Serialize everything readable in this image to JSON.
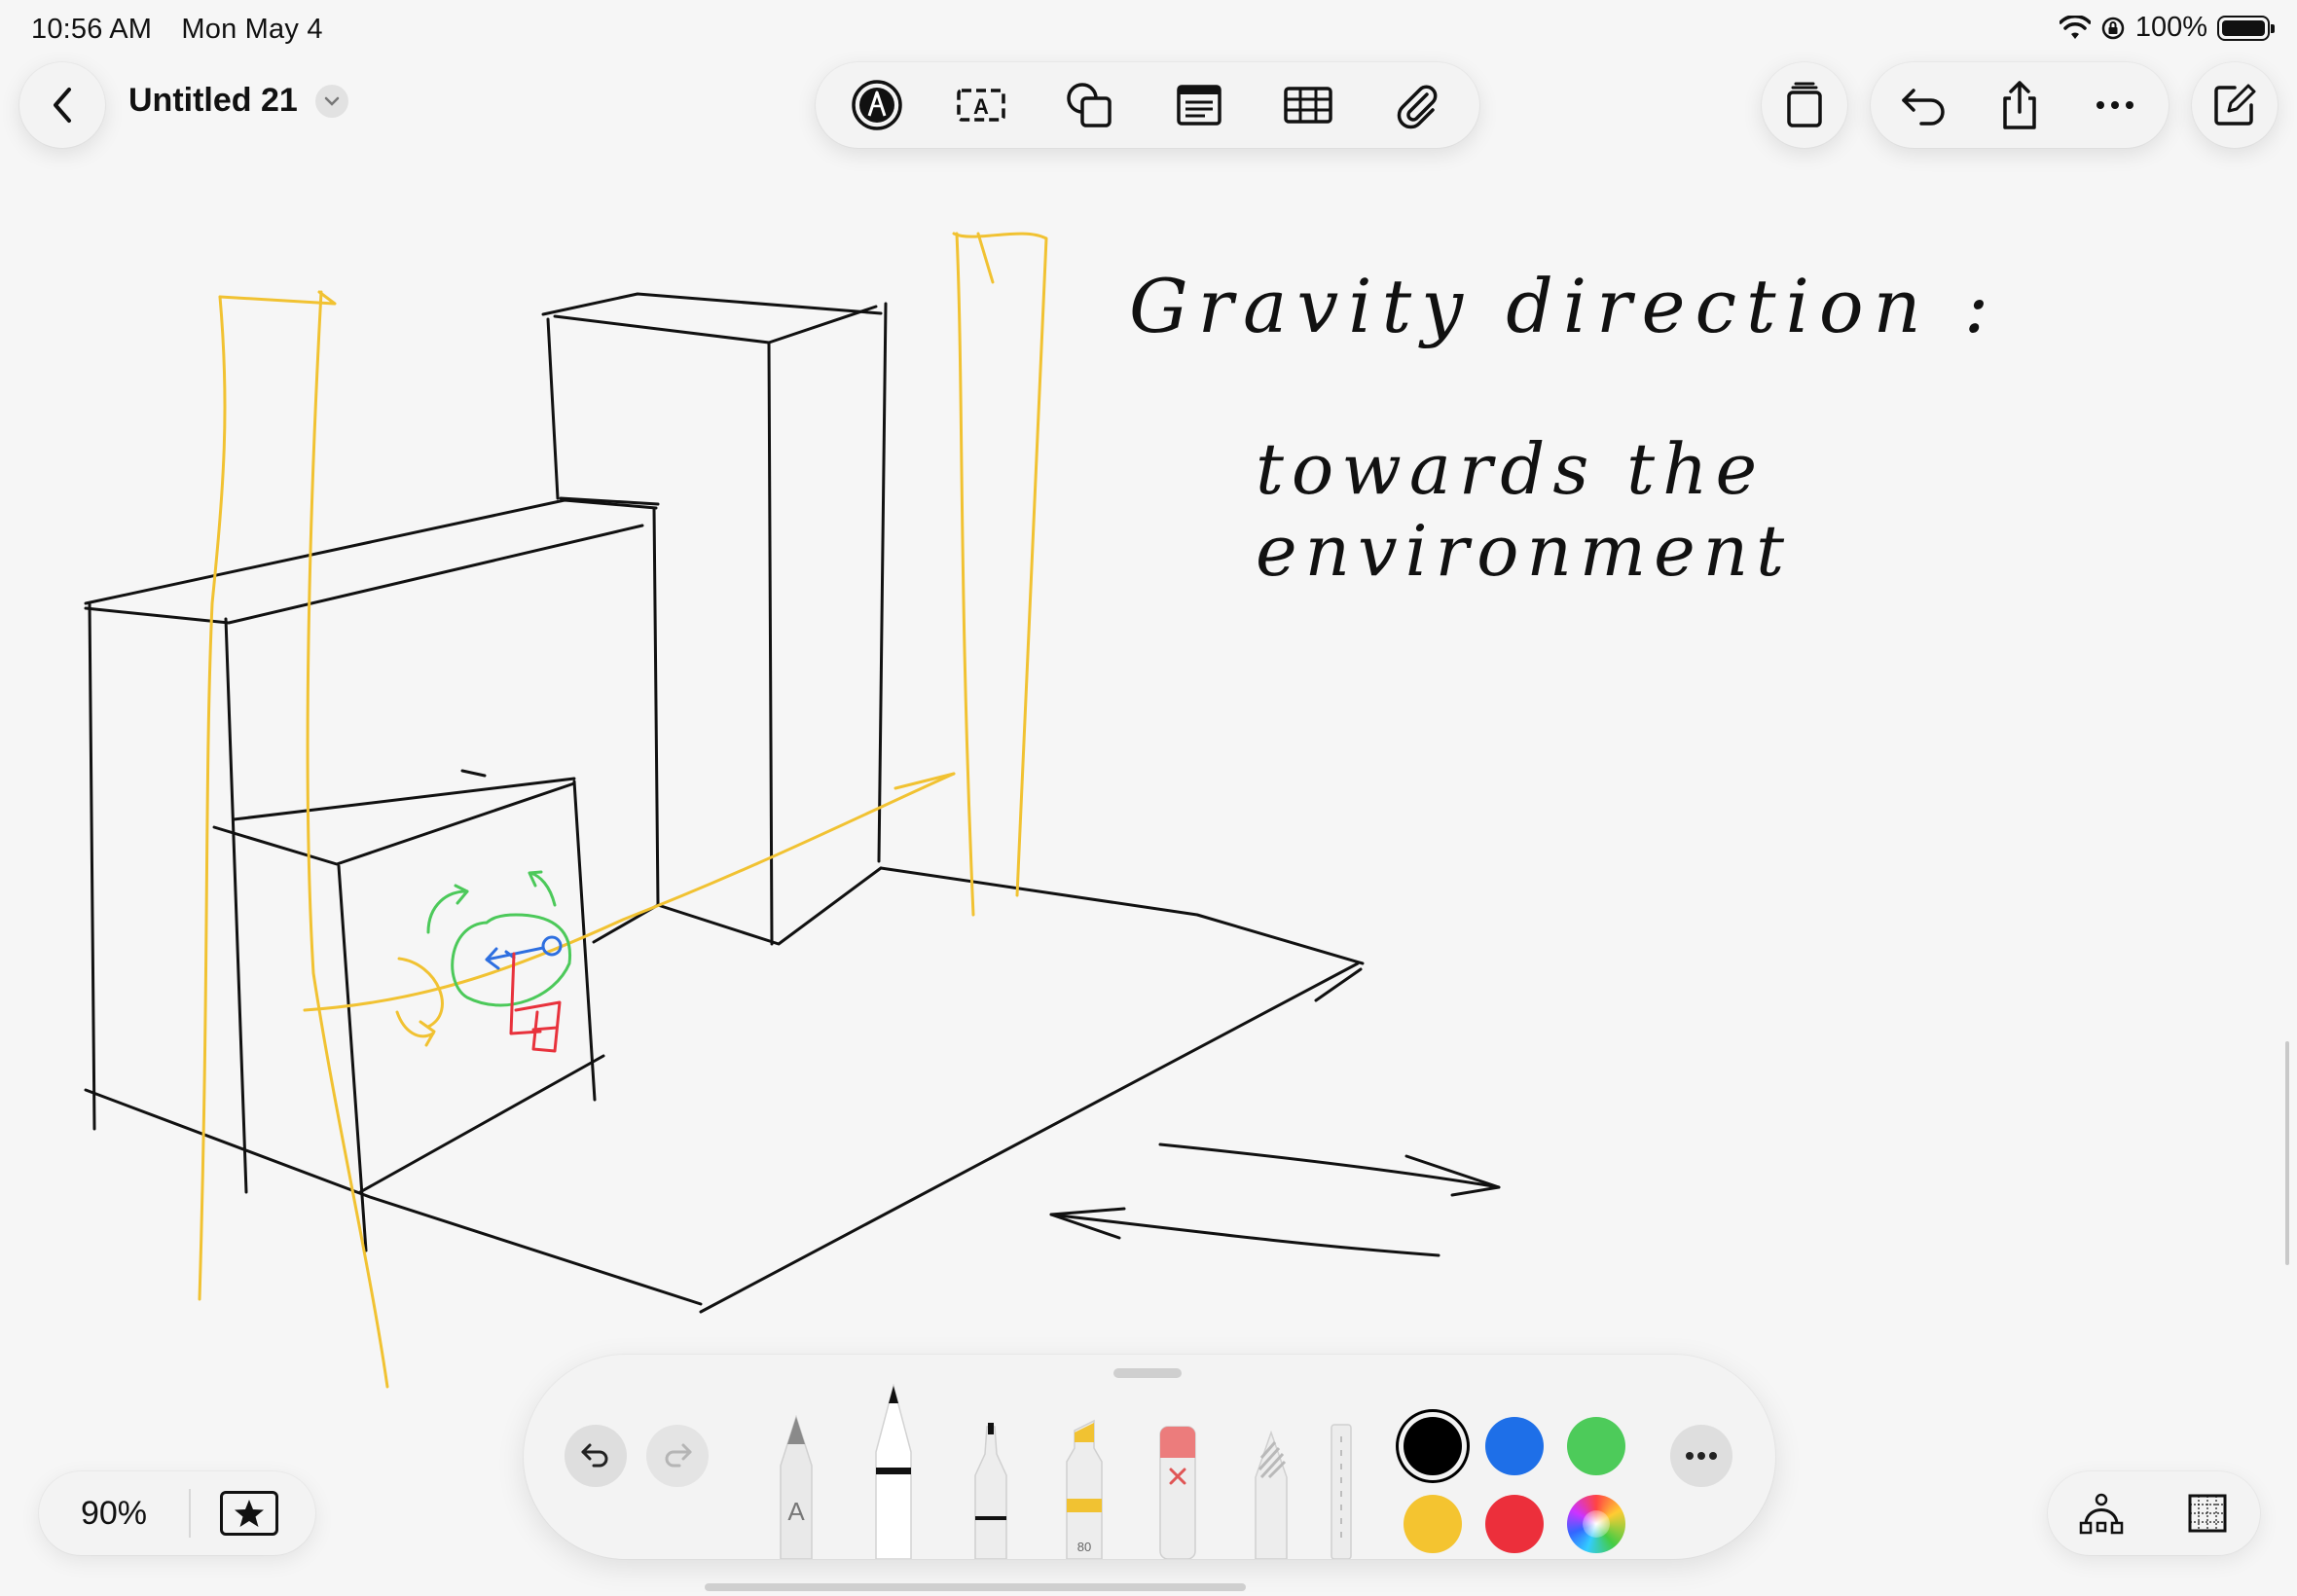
{
  "status_bar": {
    "time": "10:56 AM",
    "date": "Mon May 4",
    "battery": "100%"
  },
  "header": {
    "title": "Untitled 21"
  },
  "toolbar": {
    "center": [
      "markup-icon",
      "text-box-icon",
      "shapes-icon",
      "text-card-icon",
      "table-icon",
      "attachment-icon"
    ],
    "right": [
      "pages-icon",
      "undo-icon",
      "share-icon",
      "more-icon",
      "compose-icon"
    ]
  },
  "canvas": {
    "handwriting_line1": "Gravity direction :",
    "handwriting_line2": "towards the environment",
    "colors": {
      "ink": "#111111",
      "yellow": "#f1c232",
      "green": "#4cc95a",
      "blue": "#2e6fe0",
      "red": "#e8323c"
    }
  },
  "palette": {
    "tools": [
      "pen-A-tool",
      "marker-tool",
      "fineliner-tool",
      "highlighter-tool",
      "eraser-tool",
      "pencil-tool",
      "ruler-tool"
    ],
    "highlighter_label": "80",
    "colors": [
      "#000000",
      "#1e6fe8",
      "#4dcb5a",
      "#f4c430",
      "#ec2f3b",
      "multicolor"
    ],
    "selected_color": "#000000"
  },
  "zoom": {
    "level": "90%"
  }
}
